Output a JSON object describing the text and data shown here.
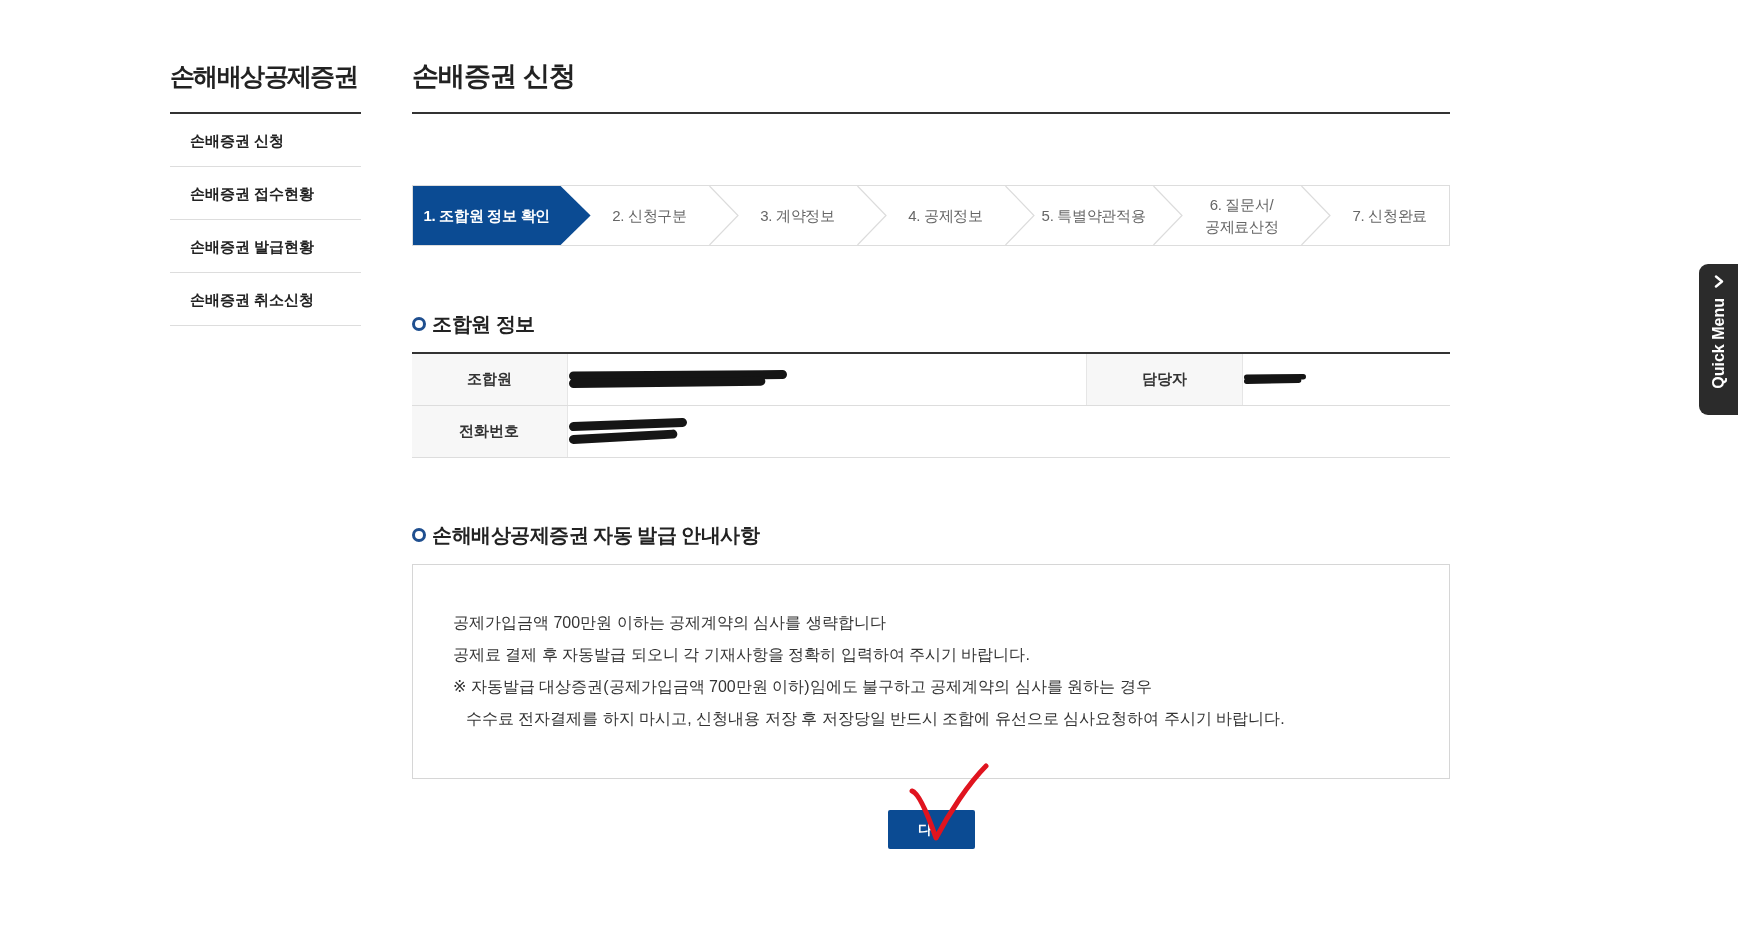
{
  "sidebar": {
    "title": "손해배상공제증권",
    "items": [
      {
        "label": "손배증권 신청"
      },
      {
        "label": "손배증권 접수현황"
      },
      {
        "label": "손배증권 발급현황"
      },
      {
        "label": "손배증권 취소신청"
      }
    ]
  },
  "page_title": "손배증권 신청",
  "steps": [
    {
      "label": "1. 조합원 정보 확인",
      "selected": true
    },
    {
      "label": "2. 신청구분",
      "selected": false
    },
    {
      "label": "3. 계약정보",
      "selected": false
    },
    {
      "label": "4. 공제정보",
      "selected": false
    },
    {
      "label": "5. 특별약관적용",
      "selected": false
    },
    {
      "label": "6. 질문서/\n공제료산정",
      "selected": false
    },
    {
      "label": "7. 신청완료",
      "selected": false
    }
  ],
  "member_info": {
    "title": "조합원 정보",
    "rows": [
      {
        "cells": [
          {
            "label": "조합원",
            "redacted": true
          },
          {
            "label": "담당자",
            "redacted": true
          }
        ]
      },
      {
        "cells": [
          {
            "label": "전화번호",
            "redacted": true
          }
        ]
      }
    ]
  },
  "notice": {
    "title": "손해배상공제증권 자동 발급 안내사항",
    "lines": [
      {
        "kind": "plain",
        "text": "공제가입금액 700만원 이하는 공제계약의 심사를 생략합니다"
      },
      {
        "kind": "plain",
        "text": "공제료 결제 후 자동발급 되오니 각 기재사항을 정확히 입력하여 주시기 바랍니다."
      },
      {
        "kind": "plain",
        "text": "※ 자동발급 대상증권(공제가입금액 700만원 이하)임에도 불구하고 공제계약의 심사를 원하는 경우"
      },
      {
        "kind": "indent",
        "text": "수수료 전자결제를 하지 마시고, 신청내용 저장 후 저장당일 반드시 조합에 유선으로 심사요청하여 주시기 바랍니다."
      }
    ]
  },
  "next_button": {
    "label": "다",
    "hand_check": true
  },
  "quick_menu": {
    "label": "Quick Menu"
  }
}
